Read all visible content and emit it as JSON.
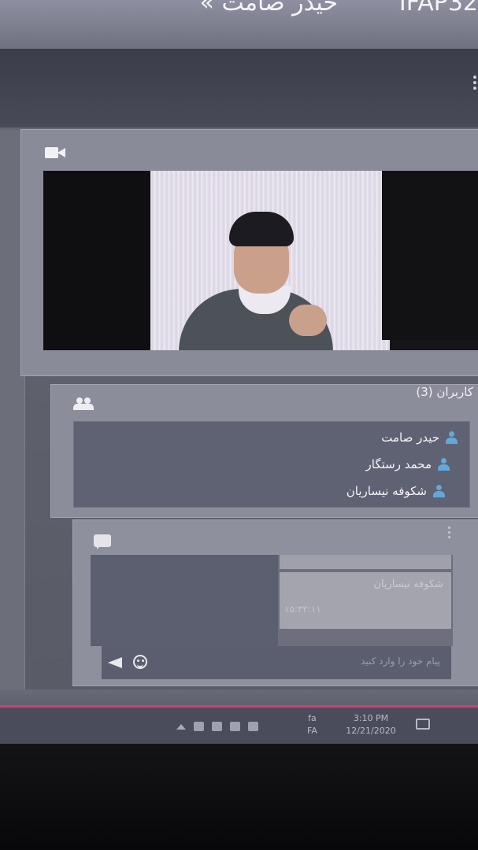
{
  "window": {
    "title": "حیدر صامت »",
    "title_suffix": "IFAP32"
  },
  "video": {
    "icon": "video-camera-icon"
  },
  "users": {
    "title": "کاربران (3)",
    "icon": "users-icon",
    "list": [
      {
        "name": "حیدر صامت"
      },
      {
        "name": "محمد رستگار"
      },
      {
        "name": "شکوفه نیساریان"
      }
    ]
  },
  "chat": {
    "icon": "chat-icon",
    "messages": [
      {
        "sender": "شکوفه نیساریان",
        "time": "۱۵:۳۲:۱۱"
      }
    ],
    "input_placeholder": "پیام خود را وارد کنید",
    "send_icon": "send-icon",
    "emoji_icon": "emoji-icon"
  },
  "taskbar": {
    "lang_top": "fa",
    "lang_bottom": "FA",
    "time": "3:10 PM",
    "date": "12/21/2020"
  },
  "colors": {
    "accent_red": "#c7456a",
    "user_icon": "#63a8d8"
  }
}
